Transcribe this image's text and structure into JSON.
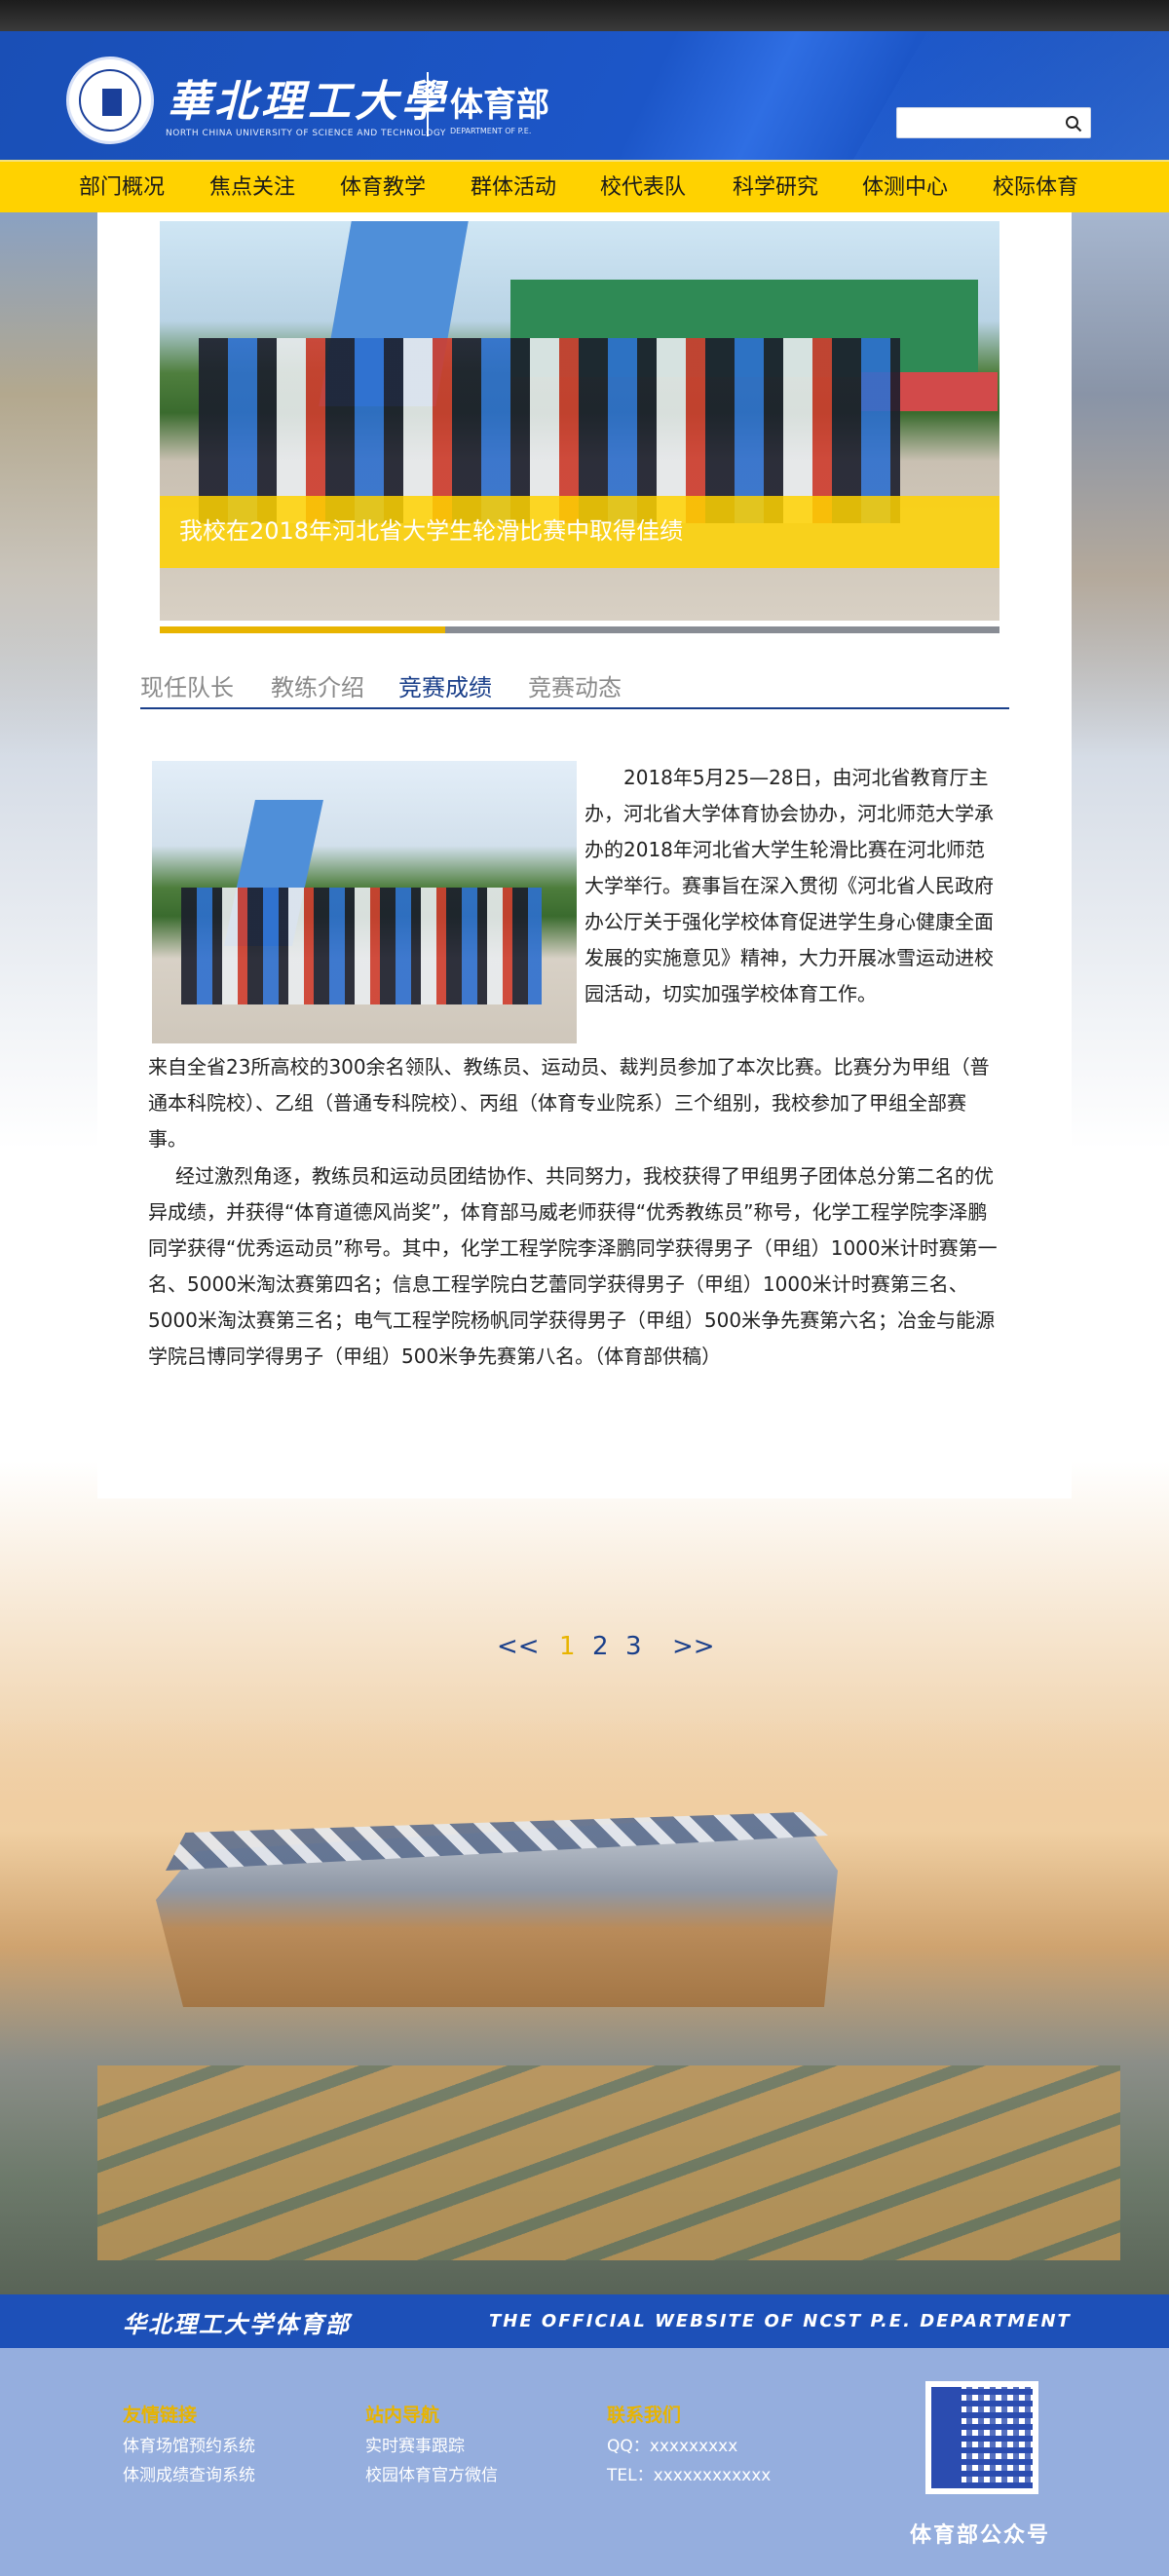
{
  "header": {
    "school_name": "華北理工大學",
    "school_name_en": "NORTH CHINA UNIVERSITY OF SCIENCE AND TECHNOLOGY",
    "dept_name": "体育部",
    "dept_name_en": "DEPARTMENT OF P.E."
  },
  "search": {
    "placeholder": "",
    "value": ""
  },
  "nav": {
    "items": [
      {
        "label": "部门概况"
      },
      {
        "label": "焦点关注"
      },
      {
        "label": "体育教学"
      },
      {
        "label": "群体活动"
      },
      {
        "label": "校代表队"
      },
      {
        "label": "科学研究"
      },
      {
        "label": "体测中心"
      },
      {
        "label": "校际体育"
      }
    ]
  },
  "banner": {
    "caption": "我校在2018年河北省大学生轮滑比赛中取得佳绩",
    "active_slide_fraction": 0.34
  },
  "tabs": {
    "items": [
      {
        "label": "现任队长"
      },
      {
        "label": "教练介绍"
      },
      {
        "label": "竞赛成绩"
      },
      {
        "label": "竞赛动态"
      }
    ],
    "active_index": 2
  },
  "article": {
    "p1": "2018年5月25—28日，由河北省教育厅主办，河北省大学体育协会协办，河北师范大学承办的2018年河北省大学生轮滑比赛在河北师范大学举行。赛事旨在深入贯彻《河北省人民政府办公厅关于强化学校体育促进学生身心健康全面发展的实施意见》精神，大力开展冰雪运动进校园活动，切实加强学校体育工作。",
    "p2": "来自全省23所高校的300余名领队、教练员、运动员、裁判员参加了本次比赛。比赛分为甲组（普通本科院校）、乙组（普通专科院校）、丙组（体育专业院系）三个组别，我校参加了甲组全部赛事。",
    "p3": "经过激烈角逐，教练员和运动员团结协作、共同努力，我校获得了甲组男子团体总分第二名的优异成绩，并获得“体育道德风尚奖”，体育部马威老师获得“优秀教练员”称号，化学工程学院李泽鹏同学获得“优秀运动员”称号。其中，化学工程学院李泽鹏同学获得男子（甲组）1000米计时赛第一名、5000米淘汰赛第四名；信息工程学院白艺蕾同学获得男子（甲组）1000米计时赛第三名、5000米淘汰赛第三名；电气工程学院杨帆同学获得男子（甲组）500米争先赛第六名；冶金与能源学院吕博同学得男子（甲组）500米争先赛第八名。（体育部供稿）"
  },
  "pagination": {
    "prev": "<<",
    "pages": [
      "1",
      "2",
      "3"
    ],
    "current": "1",
    "next": ">>"
  },
  "footer": {
    "band_cn": "华北理工大学体育部",
    "band_en": "THE OFFICIAL WEBSITE OF NCST P.E. DEPARTMENT",
    "col1": {
      "title": "友情链接",
      "links": [
        "体育场馆预约系统",
        "体测成绩查询系统"
      ]
    },
    "col2": {
      "title": "站内导航",
      "links": [
        "实时赛事跟踪",
        "校园体育官方微信"
      ]
    },
    "col3": {
      "title": "联系我们",
      "links": [
        "QQ：xxxxxxxxx",
        "TEL：xxxxxxxxxxxx"
      ]
    },
    "qr_label": "体育部公众号"
  },
  "colors": {
    "brand_blue": "#1c56c8",
    "accent_yellow": "#ffd200",
    "tab_active": "#1a3f8a",
    "pager_current": "#e8b400"
  }
}
